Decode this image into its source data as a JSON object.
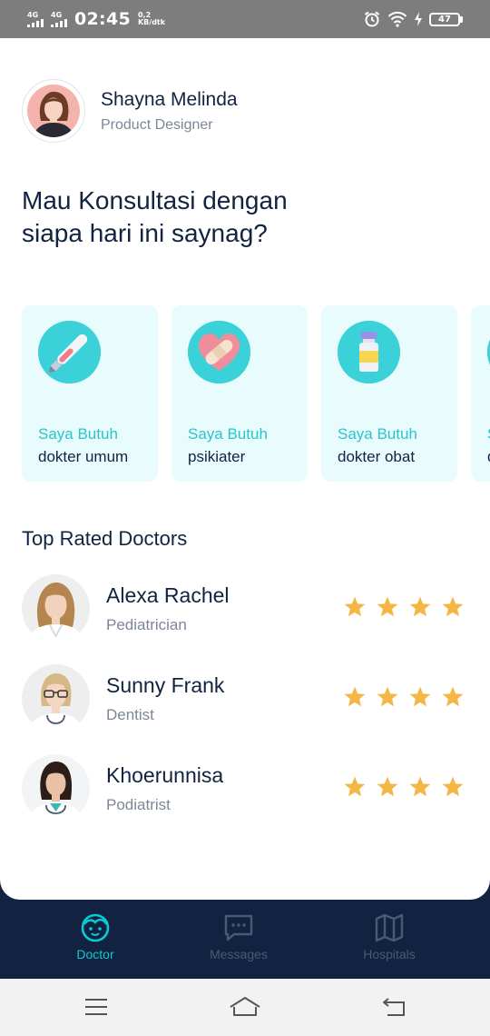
{
  "status_bar": {
    "network_1": "4G",
    "network_2": "4G",
    "time": "02:45",
    "speed_value": "0,2",
    "speed_unit": "KB/dtk",
    "battery": "47",
    "icons": [
      "signal-icon",
      "alarm-icon",
      "wifi-icon",
      "charging-icon",
      "battery-icon"
    ]
  },
  "profile": {
    "name": "Shayna Melinda",
    "job": "Product Designer"
  },
  "greeting": "Mau Konsultasi dengan siapa hari ini saynag?",
  "categories": [
    {
      "title": "Saya Butuh",
      "subtitle": "dokter umum",
      "icon": "thermometer-icon"
    },
    {
      "title": "Saya Butuh",
      "subtitle": "psikiater",
      "icon": "heart-bandage-icon"
    },
    {
      "title": "Saya Butuh",
      "subtitle": "dokter obat",
      "icon": "medicine-bottle-icon"
    },
    {
      "title": "S",
      "subtitle": "d",
      "icon": "category-icon"
    }
  ],
  "top_rated": {
    "title": "Top Rated Doctors",
    "doctors": [
      {
        "name": "Alexa Rachel",
        "specialty": "Pediatrician",
        "rating": 4
      },
      {
        "name": "Sunny Frank",
        "specialty": "Dentist",
        "rating": 4
      },
      {
        "name": "Khoerunnisa",
        "specialty": "Podiatrist",
        "rating": 4
      }
    ]
  },
  "tabbar": {
    "doctor": "Doctor",
    "messages": "Messages",
    "hospitals": "Hospitals",
    "active_color": "#0bcad4",
    "inactive_color": "#495a75"
  },
  "colors": {
    "primary_dark": "#112340",
    "accent": "#0bcad4",
    "card_bg": "#e9fcfd",
    "star": "#f4b746",
    "secondary_text": "#7d8797"
  }
}
